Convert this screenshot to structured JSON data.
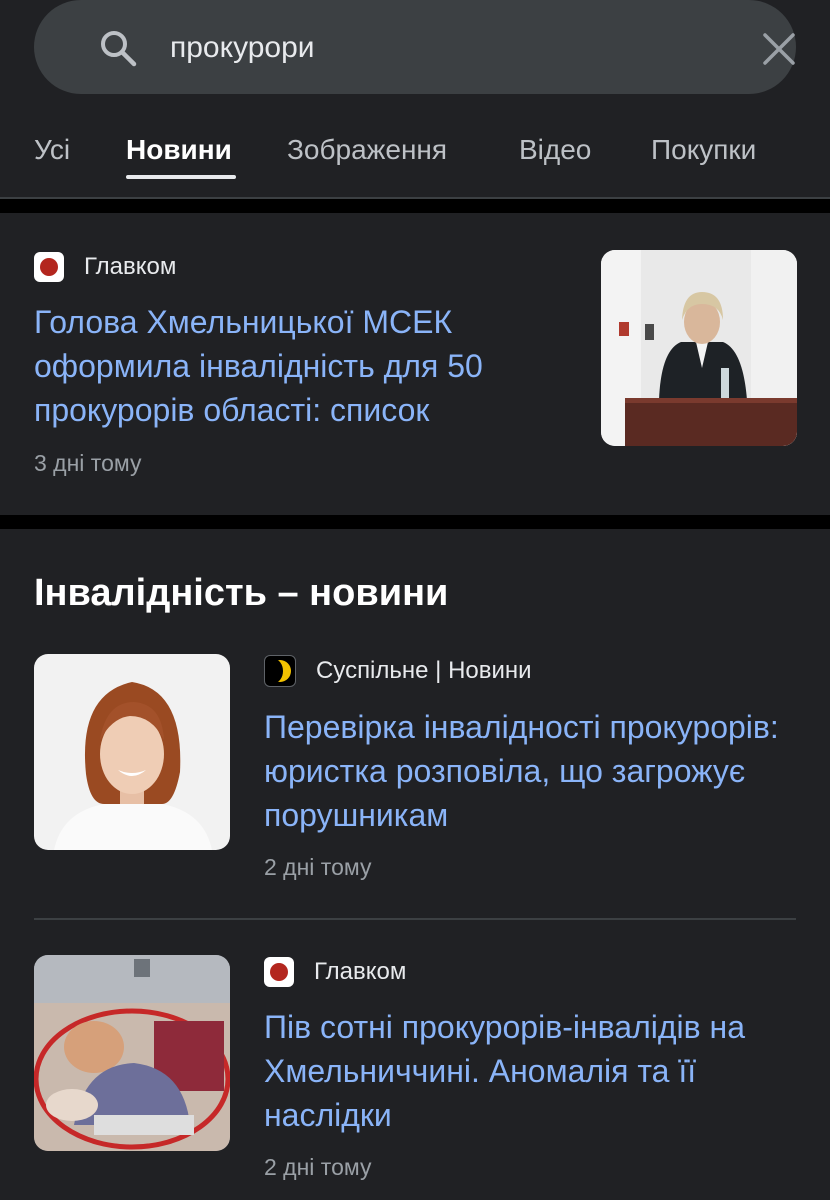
{
  "search": {
    "query": "прокурори",
    "search_icon": "search-icon",
    "clear_icon": "close-icon"
  },
  "tabs": [
    {
      "label": "Усі",
      "active": false
    },
    {
      "label": "Новини",
      "active": true
    },
    {
      "label": "Зображення",
      "active": false
    },
    {
      "label": "Відео",
      "active": false
    },
    {
      "label": "Покупки",
      "active": false
    }
  ],
  "top_story": {
    "source": "Главком",
    "headline": "Голова Хмельницької МСЕК оформила інвалідність для 50 прокурорів області: список",
    "time": "3 дні тому"
  },
  "section": {
    "title": "Інвалідність – новини",
    "items": [
      {
        "source": "Суспільне | Новини",
        "headline": "Перевірка інвалідності прокурорів: юристка розповіла, що загрожує порушникам",
        "time": "2 дні тому"
      },
      {
        "source": "Главком",
        "headline": "Пів сотні прокурорів-інвалідів на Хмельниччині. Аномалія та її наслідки",
        "time": "2 дні тому"
      }
    ]
  },
  "colors": {
    "background": "#202124",
    "link": "#8ab4f8",
    "muted": "#9aa0a6",
    "glavkom_red": "#b3261e",
    "suspilne_yellow": "#f3c200"
  }
}
